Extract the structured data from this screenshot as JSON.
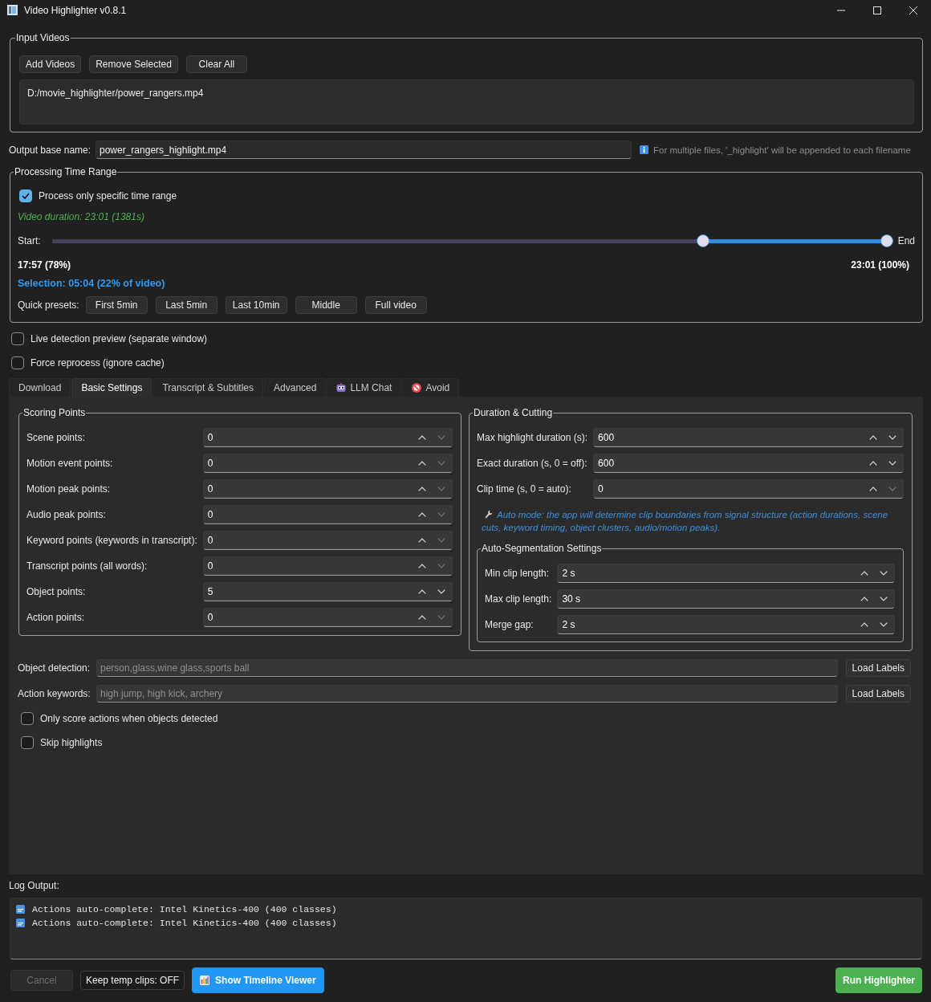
{
  "window": {
    "title": "Video Highlighter v0.8.1"
  },
  "input_videos": {
    "title": "Input Videos",
    "buttons": [
      "Add Videos",
      "Remove Selected",
      "Clear All"
    ],
    "files": [
      "D:/movie_highlighter/power_rangers.mp4"
    ]
  },
  "output": {
    "label": "Output base name:",
    "value": "power_rangers_highlight.mp4",
    "hint": "For multiple files, '_highlight' will be appended to each filename"
  },
  "time_range": {
    "title": "Processing Time Range",
    "enable": {
      "label": "Process only specific time range",
      "checked": true
    },
    "duration": "Video duration: 23:01 (1381s)",
    "start_label": "Start:",
    "end_label": "End",
    "start": {
      "level": 0.78,
      "reading": "17:57 (78%)"
    },
    "end": {
      "level": 1,
      "reading": "23:01 (100%)"
    },
    "selection": "Selection: 05:04 (22% of video)",
    "presets_label": "Quick presets:",
    "presets": [
      "First 5min",
      "Last 5min",
      "Last 10min",
      "Middle",
      "Full video"
    ]
  },
  "options": [
    {
      "label": "Live detection preview (separate window)",
      "checked": false
    },
    {
      "label": "Force reprocess (ignore cache)",
      "checked": false
    }
  ],
  "tabs": [
    {
      "label": "Download",
      "kind": "plain",
      "selected": false
    },
    {
      "label": "Basic Settings",
      "kind": "plain",
      "selected": true
    },
    {
      "label": "Transcript & Subtitles",
      "kind": "plain",
      "selected": false
    },
    {
      "label": "Advanced",
      "kind": "plain",
      "selected": false
    },
    {
      "label": "LLM Chat",
      "kind": "chat",
      "selected": false
    },
    {
      "label": "Avoid",
      "kind": "avoid",
      "selected": false
    }
  ],
  "scoring": {
    "title": "Scoring Points",
    "fields": [
      {
        "label": "Scene points:",
        "value": "0",
        "down_enabled": false
      },
      {
        "label": "Motion event points:",
        "value": "0",
        "down_enabled": false
      },
      {
        "label": "Motion peak points:",
        "value": "0",
        "down_enabled": false
      },
      {
        "label": "Audio peak points:",
        "value": "0",
        "down_enabled": false
      },
      {
        "label": "Keyword points (keywords in transcript):",
        "value": "0",
        "down_enabled": false
      },
      {
        "label": "Transcript points (all words):",
        "value": "0",
        "down_enabled": false
      },
      {
        "label": "Object points:",
        "value": "5",
        "down_enabled": true
      },
      {
        "label": "Action points:",
        "value": "0",
        "down_enabled": false
      }
    ]
  },
  "duration": {
    "title": "Duration & Cutting",
    "fields": [
      {
        "label": "Max highlight duration (s):",
        "value": "600",
        "down_enabled": true
      },
      {
        "label": "Exact duration (s, 0 = off):",
        "value": "600",
        "down_enabled": true
      },
      {
        "label": "Clip time (s, 0 = auto):",
        "value": "0",
        "down_enabled": false
      }
    ],
    "note": "Auto mode: the app will determine clip boundaries from signal structure (action durations, scene cuts, keyword timing, object clusters, audio/motion peaks).",
    "auto_segmentation": {
      "title": "Auto-Segmentation Settings",
      "fields": [
        {
          "label": "Min clip length:",
          "value": "2 s",
          "down_enabled": true
        },
        {
          "label": "Max clip length:",
          "value": "30 s",
          "down_enabled": true
        },
        {
          "label": "Merge gap:",
          "value": "2 s",
          "down_enabled": true
        }
      ]
    }
  },
  "detection": [
    {
      "label": "Object detection:",
      "placeholder": "person,glass,wine glass,sports ball",
      "button": "Load Labels"
    },
    {
      "label": "Action keywords:",
      "placeholder": "high jump, high kick, archery",
      "button": "Load Labels"
    }
  ],
  "filters": [
    {
      "label": "Only score actions when objects detected",
      "checked": false
    },
    {
      "label": "Skip highlights",
      "checked": false
    }
  ],
  "log": {
    "label": "Log Output:",
    "lines": [
      "Actions auto-complete: Intel Kinetics-400 (400 classes)",
      "Actions auto-complete: Intel Kinetics-400 (400 classes)"
    ]
  },
  "footer": {
    "buttons": [
      {
        "label": "Cancel",
        "kind": "plain",
        "disabled": true
      },
      {
        "label": "Keep temp clips: OFF",
        "kind": "plain",
        "disabled": false
      },
      {
        "label": "Show Timeline Viewer",
        "kind": "primary",
        "disabled": false
      }
    ],
    "run": "Run Highlighter"
  }
}
